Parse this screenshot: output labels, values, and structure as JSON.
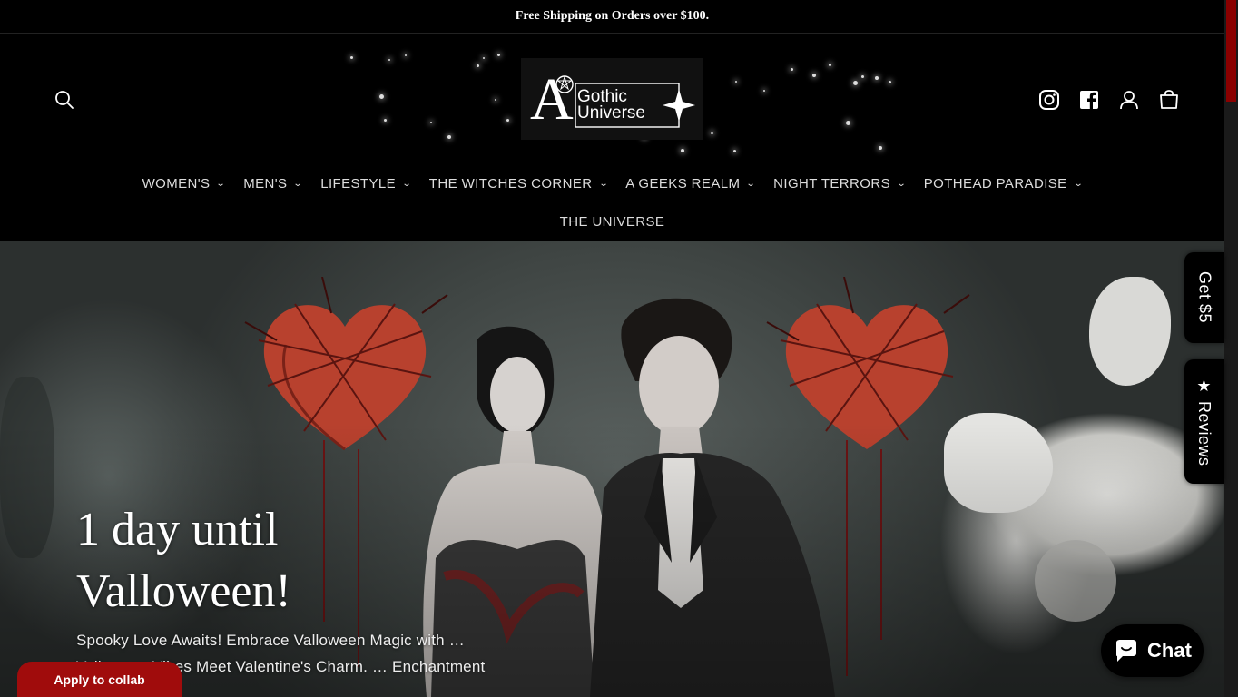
{
  "announcement": {
    "text": "Free Shipping on Orders over $100."
  },
  "header": {
    "logo": {
      "letter": "A",
      "line1": "Gothic",
      "line2": "Universe"
    },
    "icons": [
      "search-icon",
      "instagram-icon",
      "facebook-icon",
      "account-icon",
      "cart-icon"
    ]
  },
  "nav": {
    "items": [
      {
        "label": "WOMEN'S"
      },
      {
        "label": "MEN'S"
      },
      {
        "label": "LIFESTYLE"
      },
      {
        "label": "THE WITCHES CORNER"
      },
      {
        "label": "A GEEKS REALM"
      },
      {
        "label": "NIGHT TERRORS"
      },
      {
        "label": "POTHEAD PARADISE"
      }
    ],
    "row2": {
      "label": "THE UNIVERSE"
    }
  },
  "hero": {
    "title": "1 day until Valloween!",
    "text": "Spooky Love Awaits! Embrace Valloween Magic with … Valloween Vibes Meet Valentine's Charm. … Enchantment Now!"
  },
  "side_tabs": {
    "get5": "Get $5",
    "reviews": "★ Reviews"
  },
  "collab_button": "Apply to collab",
  "chat_button": "Chat",
  "colors": {
    "accent_red": "#a00c0c",
    "background": "#000000"
  }
}
